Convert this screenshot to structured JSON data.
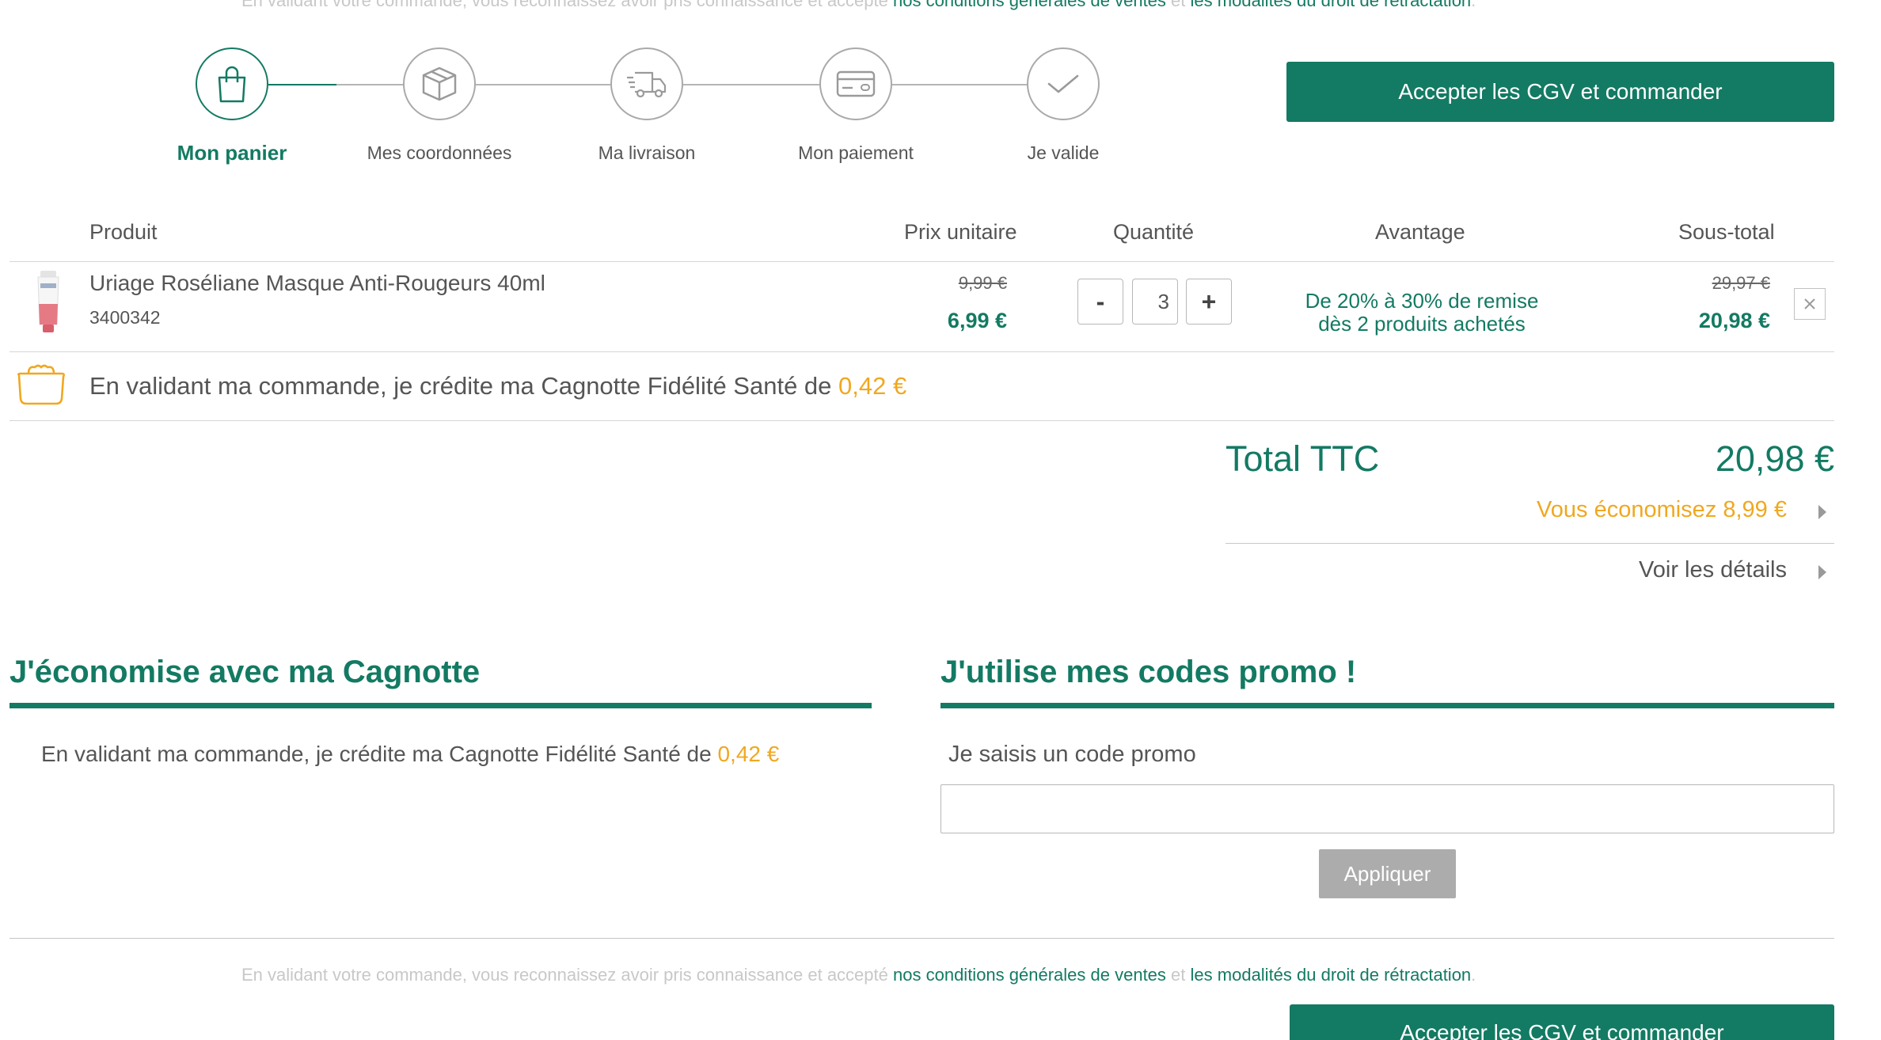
{
  "legal": {
    "prefix": "En validant votre commande, vous reconnaissez avoir pris connaissance et accepté",
    "cgv_link": "nos conditions générales de ventes",
    "and": "et",
    "retract_link": "les modalités du droit de rétractation",
    "suffix": "."
  },
  "steps": [
    {
      "label": "Mon panier",
      "icon": "shopping-bag-icon",
      "active": true
    },
    {
      "label": "Mes coordonnées",
      "icon": "package-box-icon",
      "active": false
    },
    {
      "label": "Ma livraison",
      "icon": "delivery-truck-icon",
      "active": false
    },
    {
      "label": "Mon paiement",
      "icon": "credit-card-icon",
      "active": false
    },
    {
      "label": "Je valide",
      "icon": "checkmark-icon",
      "active": false
    }
  ],
  "cta_label": "Accepter les CGV et commander",
  "table": {
    "headers": {
      "product": "Produit",
      "unit_price": "Prix unitaire",
      "quantity": "Quantité",
      "advantage": "Avantage",
      "subtotal": "Sous-total"
    },
    "item": {
      "name": "Uriage Roséliane Masque Anti-Rougeurs 40ml",
      "ref": "3400342",
      "old_price": "9,99 €",
      "price": "6,99 €",
      "quantity": "3",
      "minus": "-",
      "plus": "+",
      "advantage_line1": "De 20% à 30% de remise",
      "advantage_line2": "dès 2 produits achetés",
      "old_subtotal": "29,97 €",
      "subtotal": "20,98 €"
    },
    "cagnotte": {
      "text": "En validant ma commande, je crédite ma Cagnotte Fidélité Santé de",
      "amount": "0,42 €"
    }
  },
  "totals": {
    "label": "Total TTC",
    "value": "20,98 €",
    "savings": "Vous économisez 8,99 €",
    "details": "Voir les détails"
  },
  "cagnotte_section": {
    "title": "J'économise avec ma Cagnotte",
    "text": "En validant ma commande, je crédite ma Cagnotte Fidélité Santé de",
    "amount": "0,42 €"
  },
  "promo_section": {
    "title": "J'utilise mes codes promo !",
    "label": "Je saisis un code promo",
    "input_value": "",
    "apply_label": "Appliquer"
  },
  "colors": {
    "brand_green": "#137a63",
    "accent_orange": "#f0a820",
    "disabled_gray": "#acacac"
  }
}
